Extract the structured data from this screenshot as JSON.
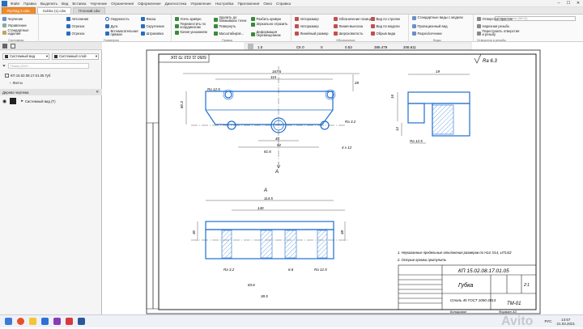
{
  "menubar": {
    "items": [
      "Файл",
      "Правка",
      "Выделить",
      "Вид",
      "Вставка",
      "Черчение",
      "Ограничения",
      "Оформление",
      "Диагностика",
      "Управление",
      "Настройка",
      "Приложения",
      "Окно",
      "Справка"
    ]
  },
  "tabs": [
    "Rychag 2.cdw",
    "Gubka (1).cdw",
    "Плоский.cdw"
  ],
  "ribbon": {
    "col1": [
      "Черчение",
      "Управление",
      "Стандартные изделия"
    ],
    "geom_a": [
      "Автолиния",
      "Отрезок",
      "Отрезок"
    ],
    "geom_b": [
      "Окружность",
      "Дуга",
      "Вспомогательная прямая"
    ],
    "geom_c": [
      "Фаска",
      "Скругление",
      "Штриховка"
    ],
    "edit_a": [
      "Усечь кривую",
      "Переместить по координатам",
      "Копия указанием"
    ],
    "edit_b": [
      "Удалить до ближайших точек",
      "Повернуть",
      "Масштабиров..."
    ],
    "edit_c": [
      "Разбить кривую",
      "Зеркально отразить",
      "Деформация перемещением"
    ],
    "dim": [
      "Авторазмер",
      "Авторазмер",
      "Линейный размер"
    ],
    "mark": [
      "Обозначение позиции",
      "Линия-выноска",
      "Шероховатость"
    ],
    "view": [
      "Вид по стрелке",
      "Вид по модели",
      "Обрыв вида"
    ],
    "views2": [
      "Стандартные виды с модели",
      "Проекционный вид",
      "Разрез/сечение"
    ],
    "holes": [
      "Отверстие простое",
      "Нарезная резьба",
      "Перестроить отверстия и резьбу"
    ],
    "search_placeholder": "Поиск в меню (Alt+Q)",
    "group_labels": [
      "Системная",
      "Геометрия",
      "Правка",
      "Обозначения",
      "Виды",
      "Отверстия и резьбы"
    ],
    "toolbar_values": [
      "1.0",
      "СК 0",
      "0",
      "0.53",
      "385.479",
      "206.611"
    ]
  },
  "left": {
    "layer_system_view": "Системный вид",
    "layer_system_layer": "Системный слой",
    "search": "Поиск (Ctrl+...",
    "doc_name": "КП 15.02.08.17.01.05 Губ",
    "sheets": "Листы",
    "view_item": "Системный вид (Т)",
    "tree_title": "Дерево чертежа"
  },
  "drawing": {
    "stamp_top": "5050 11 010 70 11K",
    "roughness": "Ra 6.3",
    "section_label": "А",
    "dims": [
      "167.5",
      "115",
      "80.3",
      "28",
      "40",
      "52",
      "61.6",
      "114.5",
      "140",
      "6.6",
      "4 x 12",
      "Ra 12.5",
      "Ra 3.2",
      "19",
      "16",
      "12",
      "30",
      "48",
      "83.6",
      "38.5",
      "Ra 12.5",
      "Ra 12.5",
      "Ra 3.2"
    ],
    "notes": [
      "1. Неуказанные предельные отклонения размеров по H14, h14, ±IT14/2",
      "2. Острые кромки притупить"
    ],
    "title_code": "КП 15.02.08.17.01.05",
    "title_name": "Губка",
    "material": "Сталь 45 ГОСТ 1050-2013",
    "group": "ТМ-01",
    "scale": "2:1",
    "bottom_labels": [
      "Копировал",
      "Формат А3"
    ]
  },
  "taskbar": {
    "lang": "РУС",
    "time": "14:57",
    "date": "21.03.2021",
    "watermark": "Avito"
  },
  "colors": {
    "blue": "#1f6fd0",
    "orange": "#ef8a2a"
  }
}
